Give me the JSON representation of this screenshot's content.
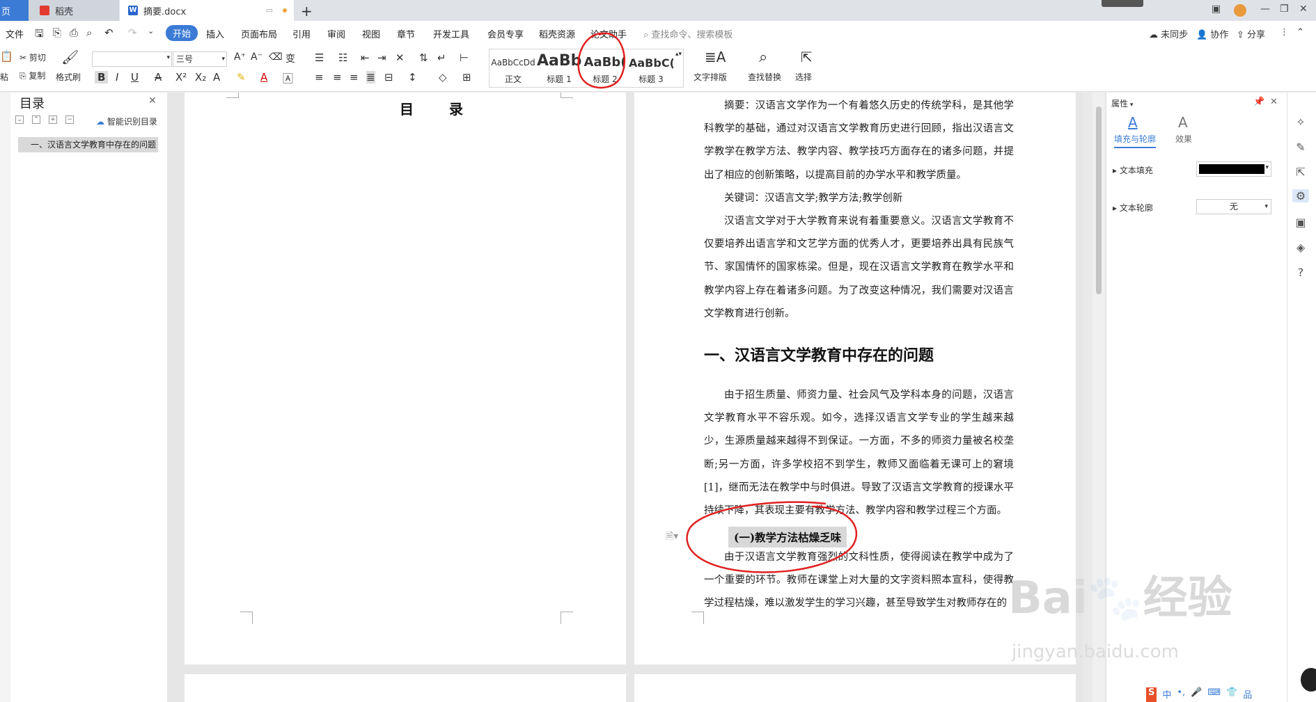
{
  "titlebar": {
    "tab_home": "页",
    "tab_daoke": "稻壳",
    "tab_doc": "摘要.docx",
    "new_tab": "+"
  },
  "menubar": {
    "file": "文件",
    "items": [
      "开始",
      "插入",
      "页面布局",
      "引用",
      "审阅",
      "视图",
      "章节",
      "开发工具",
      "会员专享",
      "稻壳资源",
      "论文助手"
    ],
    "search_placeholder": "查找命令、搜索模板",
    "right": [
      "未同步",
      "协作",
      "分享"
    ]
  },
  "ribbon": {
    "cut": "剪切",
    "copy": "复制",
    "paste": "粘",
    "format_painter": "格式刷",
    "font_name": "",
    "font_size": "三号",
    "styles": [
      {
        "preview": "AaBbCcDd",
        "label": "正文"
      },
      {
        "preview": "AaBb",
        "label": "标题 1"
      },
      {
        "preview": "AaBb(",
        "label": "标题 2"
      },
      {
        "preview": "AaBbC(",
        "label": "标题 3"
      }
    ],
    "text_layout": "文字排版",
    "find_replace": "查找替换",
    "select": "选择"
  },
  "nav": {
    "title": "目录",
    "smart": "智能识别目录",
    "entry": "一、汉语言文学教育中存在的问题"
  },
  "document": {
    "toc_title": "目 录",
    "abstract": "摘要：汉语言文学作为一个有着悠久历史的传统学科，是其他学科教学的基础，通过对汉语言文学教育历史进行回顾，指出汉语言文学教学在教学方法、教学内容、教学技巧方面存在的诸多问题，并提出了相应的创新策略，以提高目前的办学水平和教学质量。",
    "keywords": "关键词：汉语言文学;教学方法;教学创新",
    "intro": "汉语言文学对于大学教育来说有着重要意义。汉语言文学教育不仅要培养出语言学和文艺学方面的优秀人才，更要培养出具有民族气节、家国情怀的国家栋梁。但是，现在汉语言文学教育在教学水平和教学内容上存在着诸多问题。为了改变这种情况，我们需要对汉语言文学教育进行创新。",
    "heading1": "一、汉语言文学教育中存在的问题",
    "para1": "由于招生质量、师资力量、社会风气及学科本身的问题，汉语言文学教育水平不容乐观。如今，选择汉语言文学专业的学生越来越少，生源质量越来越得不到保证。一方面，不多的师资力量被名校垄断;另一方面，许多学校招不到学生，教师又面临着无课可上的窘境[1]，继而无法在教学中与时俱进。导致了汉语言文学教育的授课水平持续下降，其表现主要有教学方法、教学内容和教学过程三个方面。",
    "heading2": "(一)教学方法枯燥乏味",
    "para2": "由于汉语言文学教育强烈的文科性质，使得阅读在教学中成为了一个重要的环节。教师在课堂上对大量的文字资料照本宣科，使得教学过程枯燥，难以激发学生的学习兴趣，甚至导致学生对教师存在的"
  },
  "props": {
    "title": "属性",
    "tab_fill": "填充与轮廓",
    "tab_effect": "效果",
    "text_fill": "文本填充",
    "text_outline": "文本轮廓",
    "outline_value": "无"
  },
  "watermark": {
    "brand": "Bai",
    "brand2": "经验",
    "url": "jingyan.baidu.com"
  },
  "ime": [
    "中",
    "•,",
    "🎤",
    "⌨",
    "👕",
    "品"
  ],
  "colors": {
    "accent": "#3b7bd6",
    "annotation": "#e02020"
  }
}
